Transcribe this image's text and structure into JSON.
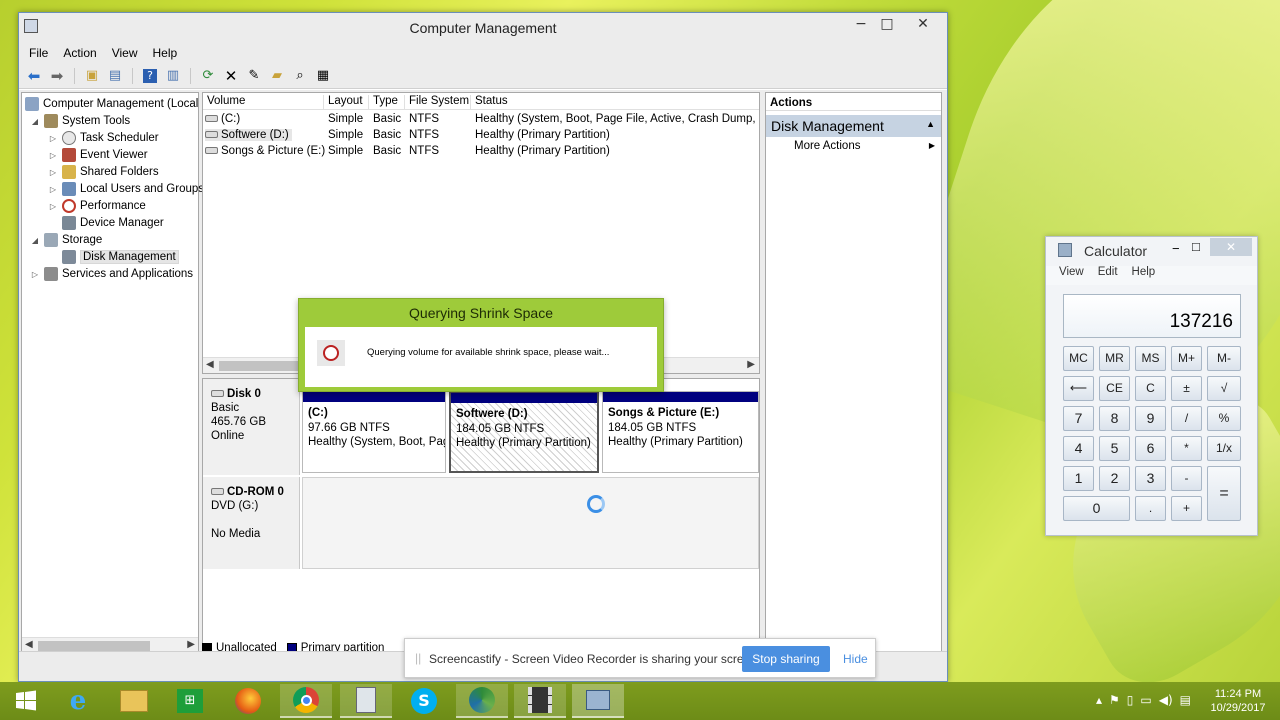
{
  "window": {
    "title": "Computer Management",
    "min": "−",
    "max": "□",
    "close": "✕"
  },
  "menu": [
    "File",
    "Action",
    "View",
    "Help"
  ],
  "tree": {
    "root": "Computer Management (Local",
    "system_tools": "System Tools",
    "task_scheduler": "Task Scheduler",
    "event_viewer": "Event Viewer",
    "shared_folders": "Shared Folders",
    "local_users": "Local Users and Groups",
    "performance": "Performance",
    "device_manager": "Device Manager",
    "storage": "Storage",
    "disk_management": "Disk Management",
    "services": "Services and Applications"
  },
  "volume_table": {
    "headers": [
      "Volume",
      "Layout",
      "Type",
      "File System",
      "Status"
    ],
    "rows": [
      [
        "(C:)",
        "Simple",
        "Basic",
        "NTFS",
        "Healthy (System, Boot, Page File, Active, Crash Dump, Pri"
      ],
      [
        "Softwere (D:)",
        "Simple",
        "Basic",
        "NTFS",
        "Healthy (Primary Partition)"
      ],
      [
        "Songs & Picture (E:)",
        "Simple",
        "Basic",
        "NTFS",
        "Healthy (Primary Partition)"
      ]
    ]
  },
  "disk0": {
    "name": "Disk 0",
    "type": "Basic",
    "size": "465.76 GB",
    "state": "Online",
    "partitions": [
      {
        "name": "(C:)",
        "size": "97.66 GB NTFS",
        "status": "Healthy (System, Boot, Pag"
      },
      {
        "name": "Softwere  (D:)",
        "size": "184.05 GB NTFS",
        "status": "Healthy (Primary Partition)"
      },
      {
        "name": "Songs & Picture  (E:)",
        "size": "184.05 GB NTFS",
        "status": "Healthy (Primary Partition)"
      }
    ]
  },
  "cdrom": {
    "name": "CD-ROM 0",
    "drive": "DVD (G:)",
    "media": "No Media"
  },
  "legend": {
    "unallocated": "Unallocated",
    "primary": "Primary partition"
  },
  "actions": {
    "header": "Actions",
    "section": "Disk Management",
    "more": "More Actions"
  },
  "dialog": {
    "title": "Querying Shrink Space",
    "message": "Querying volume for available shrink space, please wait..."
  },
  "calculator": {
    "title": "Calculator",
    "menu": [
      "View",
      "Edit",
      "Help"
    ],
    "display": "137216",
    "keys": {
      "mc": "MC",
      "mr": "MR",
      "ms": "MS",
      "mplus": "M+",
      "mminus": "M-",
      "back": "⟵",
      "ce": "CE",
      "c": "C",
      "pm": "±",
      "sqrt": "√",
      "k7": "7",
      "k8": "8",
      "k9": "9",
      "div": "/",
      "pct": "%",
      "k4": "4",
      "k5": "5",
      "k6": "6",
      "mul": "*",
      "recip": "1/x",
      "k1": "1",
      "k2": "2",
      "k3": "3",
      "sub": "-",
      "eq": "=",
      "k0": "0",
      "dot": ".",
      "add": "+"
    }
  },
  "screencastify": {
    "message": "Screencastify - Screen Video Recorder is sharing your screen.",
    "stop": "Stop sharing",
    "hide": "Hide"
  },
  "taskbar": {
    "time": "11:24 PM",
    "date": "10/29/2017"
  },
  "colors": {
    "primary_partition": "#00007f",
    "dialog_green": "#9ecb3a",
    "stop_button": "#4a8fe0"
  }
}
